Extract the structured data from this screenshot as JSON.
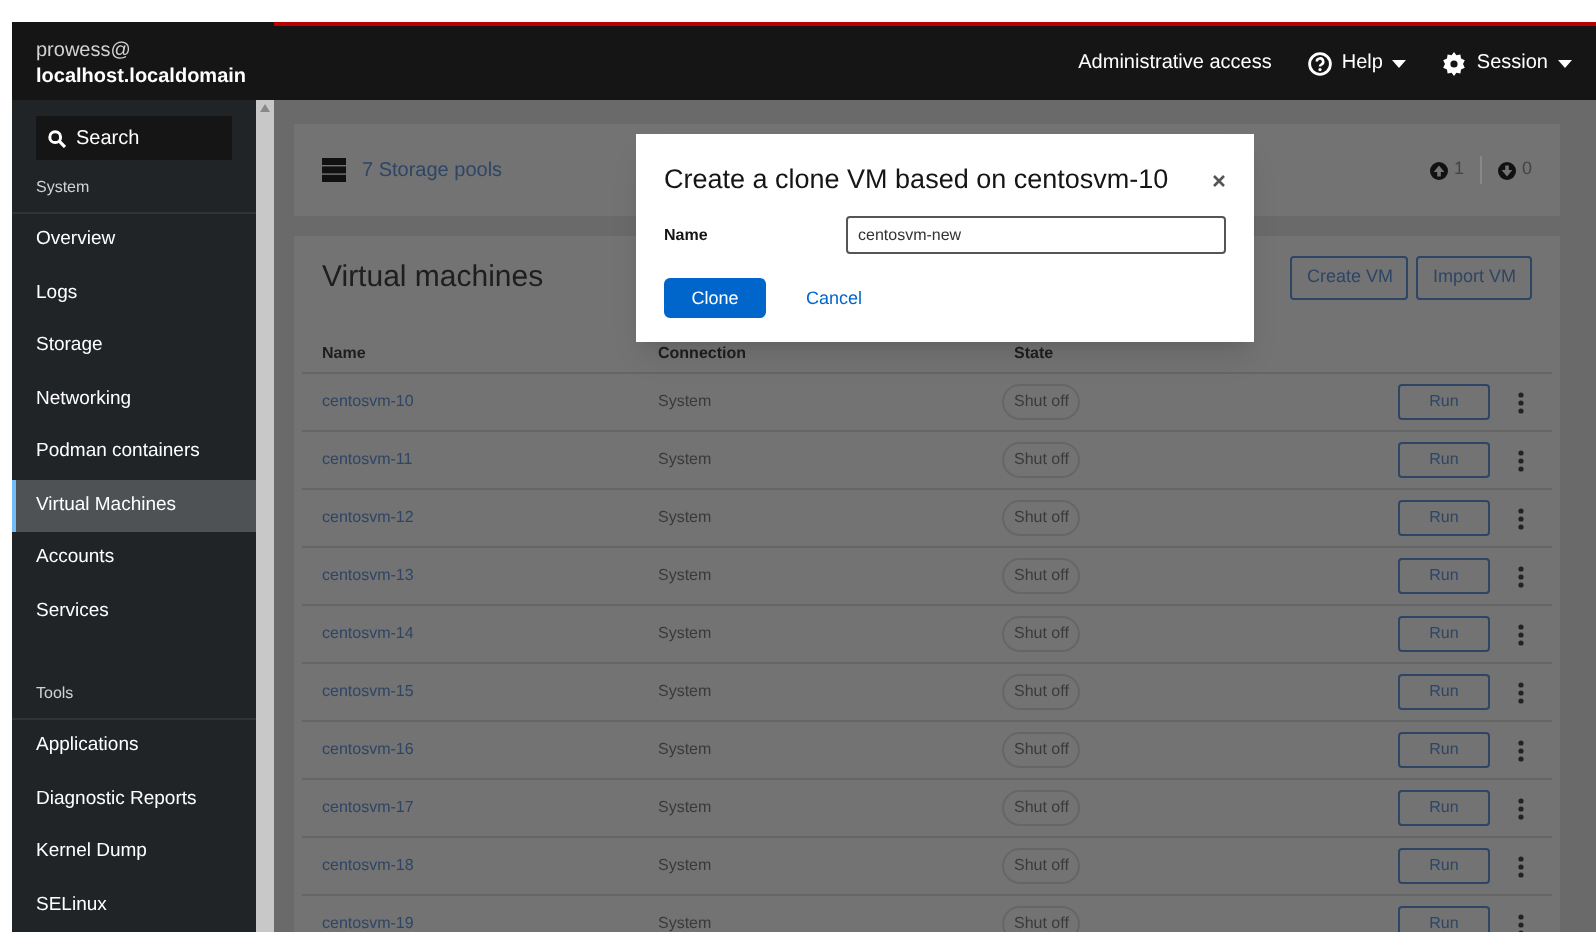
{
  "header": {
    "user": "prowess@",
    "host": "localhost.localdomain",
    "admin": "Administrative access",
    "help": "Help",
    "session": "Session"
  },
  "sidebar": {
    "search": "Search",
    "items": [
      {
        "kind": "heading",
        "label": "System"
      },
      {
        "kind": "link",
        "label": "Overview",
        "selected": false
      },
      {
        "kind": "link",
        "label": "Logs",
        "selected": false
      },
      {
        "kind": "link",
        "label": "Storage",
        "selected": false
      },
      {
        "kind": "link",
        "label": "Networking",
        "selected": false
      },
      {
        "kind": "link",
        "label": "Podman containers",
        "selected": false
      },
      {
        "kind": "link",
        "label": "Virtual Machines",
        "selected": true
      },
      {
        "kind": "link",
        "label": "Accounts",
        "selected": false
      },
      {
        "kind": "link",
        "label": "Services",
        "selected": false
      },
      {
        "kind": "heading",
        "label": "Tools"
      },
      {
        "kind": "link",
        "label": "Applications",
        "selected": false
      },
      {
        "kind": "link",
        "label": "Diagnostic Reports",
        "selected": false
      },
      {
        "kind": "link",
        "label": "Kernel Dump",
        "selected": false
      },
      {
        "kind": "link",
        "label": "SELinux",
        "selected": false
      }
    ]
  },
  "storage_card": {
    "pools": "7 Storage pools",
    "up_count": "1",
    "down_count": "0"
  },
  "vm_card": {
    "title": "Virtual machines",
    "buttons": [
      "Create VM",
      "Import VM"
    ],
    "columns": [
      "Name",
      "Connection",
      "State"
    ],
    "rows": [
      {
        "name": "centosvm-10",
        "connection": "System",
        "state": "Shut off",
        "action": "Run"
      },
      {
        "name": "centosvm-11",
        "connection": "System",
        "state": "Shut off",
        "action": "Run"
      },
      {
        "name": "centosvm-12",
        "connection": "System",
        "state": "Shut off",
        "action": "Run"
      },
      {
        "name": "centosvm-13",
        "connection": "System",
        "state": "Shut off",
        "action": "Run"
      },
      {
        "name": "centosvm-14",
        "connection": "System",
        "state": "Shut off",
        "action": "Run"
      },
      {
        "name": "centosvm-15",
        "connection": "System",
        "state": "Shut off",
        "action": "Run"
      },
      {
        "name": "centosvm-16",
        "connection": "System",
        "state": "Shut off",
        "action": "Run"
      },
      {
        "name": "centosvm-17",
        "connection": "System",
        "state": "Shut off",
        "action": "Run"
      },
      {
        "name": "centosvm-18",
        "connection": "System",
        "state": "Shut off",
        "action": "Run"
      },
      {
        "name": "centosvm-19",
        "connection": "System",
        "state": "Shut off",
        "action": "Run"
      }
    ]
  },
  "dialog": {
    "title": "Create a clone VM based on centosvm-10",
    "field_label": "Name",
    "value": "centosvm-new",
    "primary": "Clone",
    "secondary": "Cancel"
  }
}
